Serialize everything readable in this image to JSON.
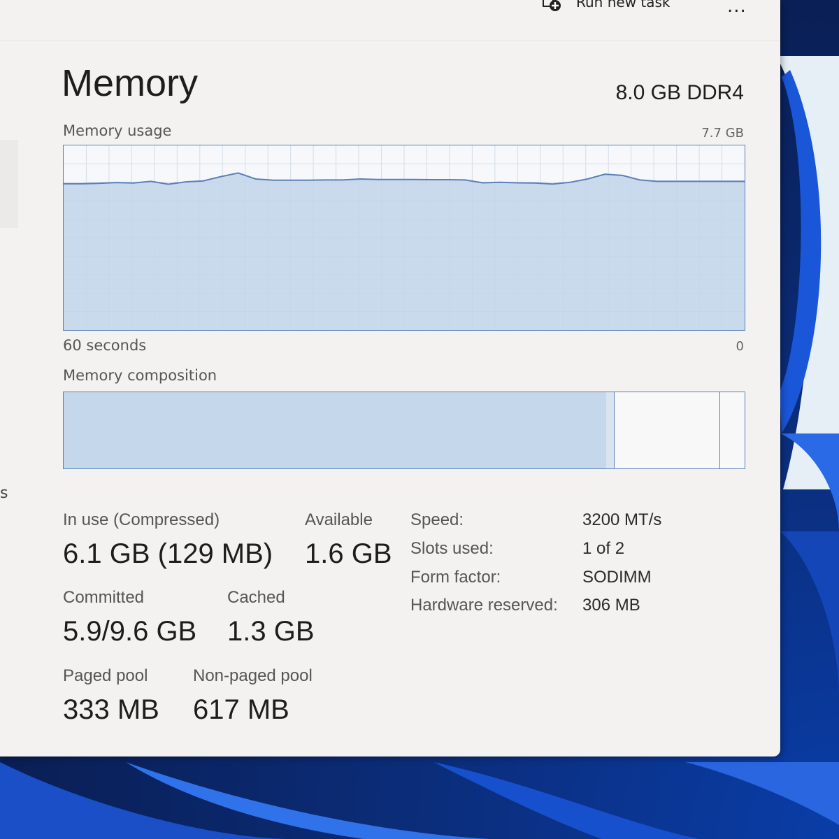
{
  "toolbar": {
    "run_new_task_label": "Run new task",
    "more_label": "..."
  },
  "left_nav": {
    "partial_text": "s"
  },
  "header": {
    "title": "Memory",
    "spec": "8.0 GB DDR4"
  },
  "usage_graph": {
    "label": "Memory usage",
    "max_label": "7.7 GB",
    "time_label": "60 seconds",
    "zero_label": "0"
  },
  "chart_data": {
    "type": "area",
    "title": "Memory usage",
    "x_range_seconds": [
      60,
      0
    ],
    "ylim_gb": [
      0,
      7.7
    ],
    "grid": true,
    "y_gb": [
      6.1,
      6.1,
      6.12,
      6.15,
      6.13,
      6.2,
      6.08,
      6.18,
      6.22,
      6.4,
      6.55,
      6.3,
      6.25,
      6.25,
      6.25,
      6.26,
      6.26,
      6.3,
      6.28,
      6.28,
      6.28,
      6.27,
      6.27,
      6.26,
      6.14,
      6.16,
      6.14,
      6.13,
      6.09,
      6.16,
      6.3,
      6.5,
      6.45,
      6.26,
      6.2,
      6.2,
      6.2,
      6.2,
      6.2,
      6.2
    ]
  },
  "composition": {
    "label": "Memory composition",
    "in_use_fraction": 0.797,
    "modified_fraction": 0.011,
    "standby_fraction": 0.155
  },
  "stats": {
    "in_use_label": "In use (Compressed)",
    "in_use_value": "6.1 GB (129 MB)",
    "available_label": "Available",
    "available_value": "1.6 GB",
    "committed_label": "Committed",
    "committed_value": "5.9/9.6 GB",
    "cached_label": "Cached",
    "cached_value": "1.3 GB",
    "paged_pool_label": "Paged pool",
    "paged_pool_value": "333 MB",
    "non_paged_pool_label": "Non-paged pool",
    "non_paged_pool_value": "617 MB"
  },
  "details": [
    {
      "key": "Speed:",
      "value": "3200 MT/s"
    },
    {
      "key": "Slots used:",
      "value": "1 of 2"
    },
    {
      "key": "Form factor:",
      "value": "SODIMM"
    },
    {
      "key": "Hardware reserved:",
      "value": "306 MB"
    }
  ],
  "colors": {
    "graph_line": "#5b7fb8",
    "graph_fill": "#c2d5ea",
    "graph_grid": "#d4dde8",
    "accent_blue": "#1e5bd6"
  }
}
